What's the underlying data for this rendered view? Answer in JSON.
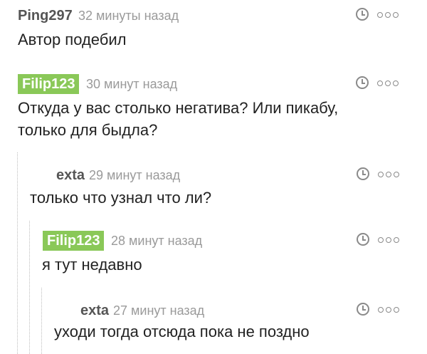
{
  "comments": [
    {
      "author": "Ping297",
      "time": "32 минуты назад",
      "text": "Автор подебил",
      "highlight": false
    },
    {
      "author": "Filip123",
      "time": "30 минут назад",
      "text": "Откуда у вас столько негатива? Или пикабу, только для быдла?",
      "highlight": true
    },
    {
      "author": "exta",
      "time": "29 минут назад",
      "text": "только что узнал что ли?",
      "highlight": false
    },
    {
      "author": "Filip123",
      "time": "28 минут назад",
      "text": "я тут недавно",
      "highlight": true
    },
    {
      "author": "exta",
      "time": "27 минут назад",
      "text": "уходи тогда отсюда пока не поздно",
      "highlight": false
    }
  ]
}
